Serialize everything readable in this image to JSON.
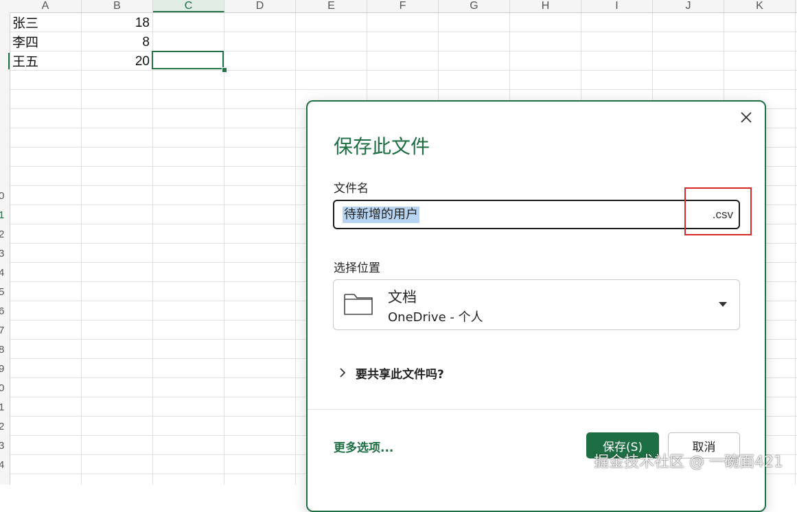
{
  "spreadsheet": {
    "columns": [
      "A",
      "B",
      "C",
      "D",
      "E",
      "F",
      "G",
      "H",
      "I",
      "J",
      "K"
    ],
    "selected_column": "C",
    "row_numbers": [
      "0",
      "1",
      "2",
      "3",
      "4",
      "5",
      "6",
      "7",
      "8",
      "9",
      "0",
      "1",
      "2",
      "3",
      "4"
    ],
    "rows": [
      {
        "name": "张三",
        "value": "18"
      },
      {
        "name": "李四",
        "value": "8"
      },
      {
        "name": "王五",
        "value": "20"
      }
    ]
  },
  "dialog": {
    "title": "保存此文件",
    "filename_label": "文件名",
    "filename_value": "待新增的用户",
    "extension": ".csv",
    "location_label": "选择位置",
    "location_name": "文档",
    "location_sub": "OneDrive - 个人",
    "share_label": "要共享此文件吗?",
    "more_options": "更多选项...",
    "save_button": "保存(S)",
    "cancel_button": "取消"
  },
  "watermark": "掘金技术社区 @ 一碗面421",
  "colors": {
    "accent": "#1e6e43",
    "highlight": "#d9262b",
    "selection": "#b7d5f3"
  }
}
